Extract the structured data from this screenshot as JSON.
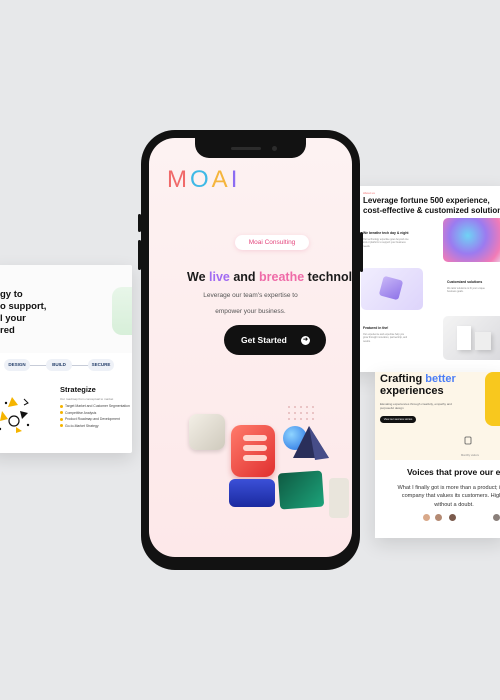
{
  "left_card": {
    "headline": "gy to\no support,\nl your\nred",
    "steps": [
      "DESIGN",
      "BUILD",
      "SECURE"
    ],
    "title": "Strategize",
    "description": "Our roadmap from conceptual to market",
    "list": [
      "Target Market and Customer Segmentation",
      "Competitive Analysis",
      "Product Roadmap and Development",
      "Go-to-Market Strategy"
    ]
  },
  "phone": {
    "logo": [
      "M",
      "O",
      "A",
      "I"
    ],
    "logo_colors": [
      "#f06a6a",
      "#3fb9e6",
      "#f5b53d",
      "#8c6cf2"
    ],
    "pill": "Moai Consulting",
    "headline": {
      "part1": "We ",
      "live": "live",
      "part2": " and ",
      "breathe": "breathe",
      "part3": " technol"
    },
    "sub_line1": "Leverage our team's expertise to",
    "sub_line2": "empower your business.",
    "cta": "Get Started",
    "cta_icon": "arrow-right-icon"
  },
  "right_card": {
    "kicker": "About us",
    "title": "Leverage fortune 500 experience, cost-effective & customized solutions.",
    "items": [
      {
        "label": "We breathe tech day & night",
        "text": "Our technology expertise goes beyond one tool or platform to support your business needs."
      },
      {
        "label": "Customized solutions",
        "text": "We tailor solutions to fit your unique business goals."
      },
      {
        "label": "Featured in the!",
        "text": "Our experience and expertise help you grow through innovation, partnership, and results."
      }
    ]
  },
  "right_card2": {
    "title_part1": "Crafting ",
    "title_better": "better",
    "title_part2": " experiences",
    "sub": "Elevating experiences through creativity, empathy and purposeful design",
    "button": "View our success stories",
    "stat": "Monthly visitors",
    "quote_title": "Voices that prove our exc",
    "testimonial": "What I finally got is more than a product; it's a company that values its customers. Highly without a doubt."
  }
}
